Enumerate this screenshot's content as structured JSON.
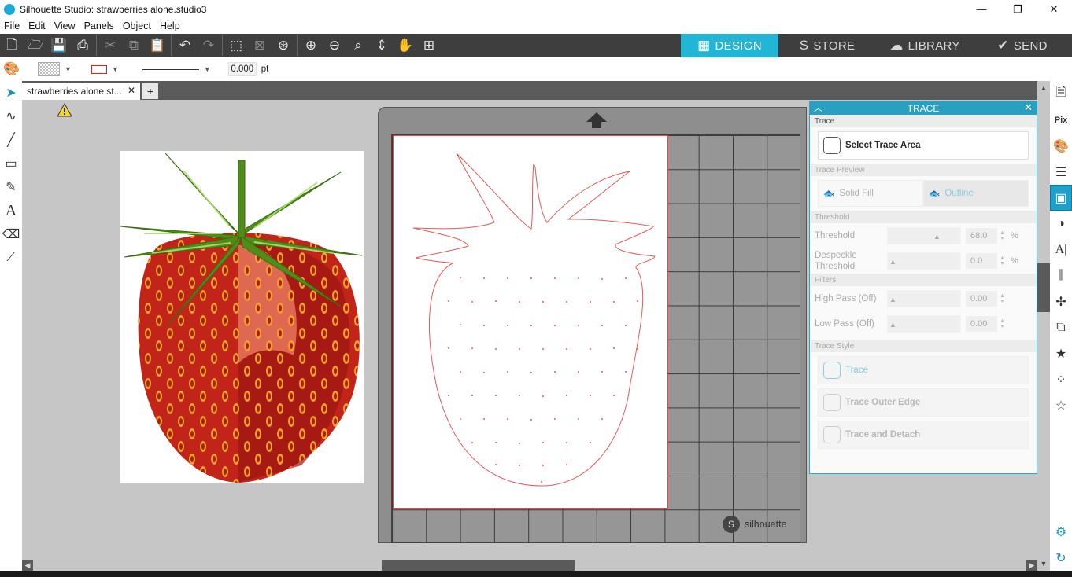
{
  "window": {
    "title": "Silhouette Studio: strawberries alone.studio3",
    "min": "—",
    "max": "❐",
    "close": "✕"
  },
  "menu": [
    "File",
    "Edit",
    "View",
    "Panels",
    "Object",
    "Help"
  ],
  "nav_tabs": [
    {
      "label": "DESIGN",
      "icon": "▦"
    },
    {
      "label": "STORE",
      "icon": "S"
    },
    {
      "label": "LIBRARY",
      "icon": "☁"
    },
    {
      "label": "SEND",
      "icon": "✔"
    }
  ],
  "properties": {
    "line_width": "0.000",
    "unit": "pt"
  },
  "document_tab": {
    "label": "strawberries alone.st...",
    "close": "✕",
    "add": "+"
  },
  "mat_brand": "silhouette",
  "trace_panel": {
    "title": "TRACE",
    "trace_label": "Trace",
    "select_trace_area": "Select Trace Area",
    "trace_preview_label": "Trace Preview",
    "solid_fill": "Solid Fill",
    "outline": "Outline",
    "threshold_section": "Threshold",
    "threshold_label": "Threshold",
    "threshold_value": "68.0",
    "despeckle_label_1": "Despeckle",
    "despeckle_label_2": "Threshold",
    "despeckle_value": "0.0",
    "filters_section": "Filters",
    "high_pass_label": "High Pass (Off)",
    "high_pass_value": "0.00",
    "low_pass_label": "Low Pass (Off)",
    "low_pass_value": "0.00",
    "trace_style_section": "Trace Style",
    "style_trace": "Trace",
    "style_outer_edge": "Trace Outer Edge",
    "style_detach": "Trace and Detach",
    "percent": "%"
  },
  "colors": {
    "accent": "#21b6d6",
    "panel_header": "#2a9fc0",
    "toolbar": "#3e3e3e",
    "trace_line": "#e55a5a"
  }
}
